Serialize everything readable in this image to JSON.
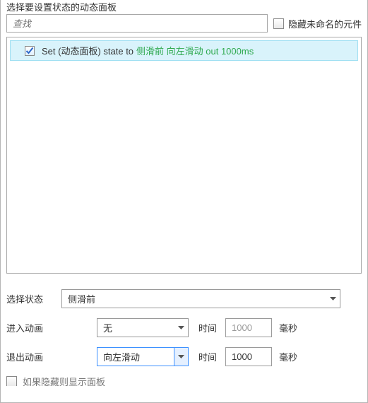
{
  "header_cut": "选择要设置状态的动态面板",
  "search": {
    "placeholder": "查找"
  },
  "hide_unnamed": {
    "label": "隐藏未命名的元件"
  },
  "list": {
    "items": [
      {
        "checked": true,
        "plain": "Set (动态面板) state to ",
        "green": "侧滑前 向左滑动 out 1000ms"
      }
    ]
  },
  "controls": {
    "state_label": "选择状态",
    "state_value": "侧滑前",
    "enter_label": "进入动画",
    "enter_value": "无",
    "exit_label": "退出动画",
    "exit_value": "向左滑动",
    "time_label": "时间",
    "enter_time": "1000",
    "exit_time": "1000",
    "unit": "毫秒"
  },
  "footer_cut": "如果隐藏则显示面板"
}
